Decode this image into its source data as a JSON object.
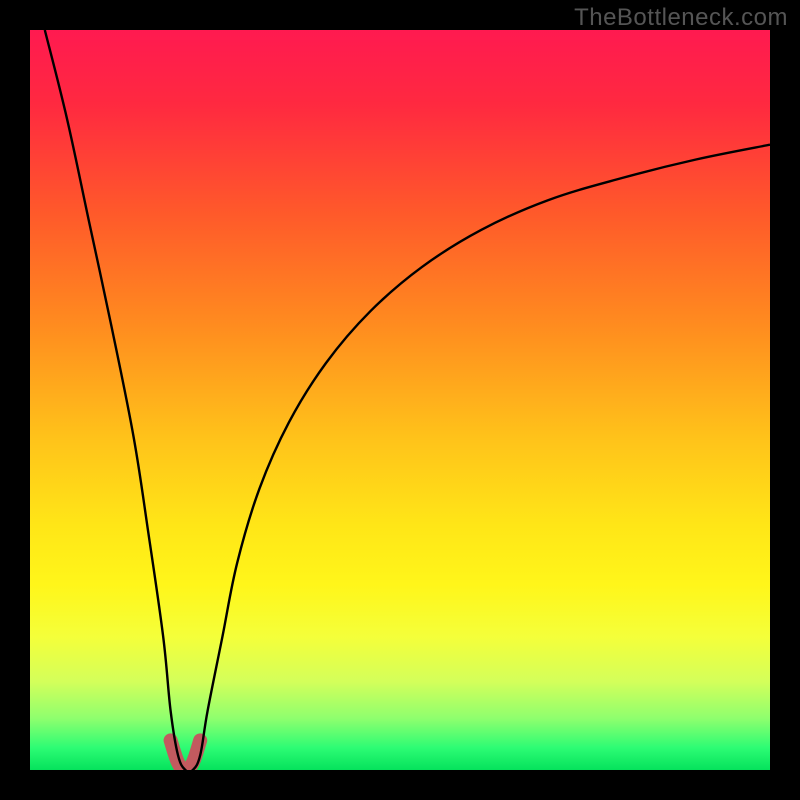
{
  "watermark": "TheBottleneck.com",
  "chart_data": {
    "type": "line",
    "title": "",
    "xlabel": "",
    "ylabel": "",
    "xlim": [
      0,
      100
    ],
    "ylim": [
      0,
      100
    ],
    "note": "V-shaped bottleneck deviation curve on a red→yellow→green vertical gradient. x is normalized horizontal position (0-100), y is percentage deviation (0 at bottom green, 100 at top red). Curve dips to ~0 near x≈21 and rises steeply on both sides.",
    "series": [
      {
        "name": "bottleneck-curve",
        "x": [
          2,
          5,
          8,
          11,
          14,
          16,
          18,
          19,
          20,
          21,
          22,
          23,
          24,
          26,
          28,
          31,
          35,
          40,
          46,
          53,
          61,
          70,
          80,
          90,
          100
        ],
        "y": [
          100,
          88,
          74,
          60,
          45,
          32,
          18,
          8,
          2,
          0,
          0,
          2,
          8,
          18,
          28,
          38,
          47,
          55,
          62,
          68,
          73,
          77,
          80,
          82.5,
          84.5
        ]
      },
      {
        "name": "valley-marker",
        "x": [
          19,
          20,
          21,
          22,
          23
        ],
        "y": [
          4,
          1,
          0,
          1,
          4
        ]
      }
    ],
    "gradient_stops": [
      {
        "offset": 0,
        "color": "#ff1a50"
      },
      {
        "offset": 10,
        "color": "#ff2940"
      },
      {
        "offset": 25,
        "color": "#ff5a2a"
      },
      {
        "offset": 40,
        "color": "#ff8c1f"
      },
      {
        "offset": 55,
        "color": "#ffc21a"
      },
      {
        "offset": 67,
        "color": "#ffe617"
      },
      {
        "offset": 75,
        "color": "#fff61a"
      },
      {
        "offset": 82,
        "color": "#f4ff3a"
      },
      {
        "offset": 88,
        "color": "#d4ff5a"
      },
      {
        "offset": 93,
        "color": "#8fff6e"
      },
      {
        "offset": 97,
        "color": "#2dfc74"
      },
      {
        "offset": 100,
        "color": "#05e25c"
      }
    ],
    "valley_color": "#c25a5f",
    "curve_color": "#000000"
  }
}
